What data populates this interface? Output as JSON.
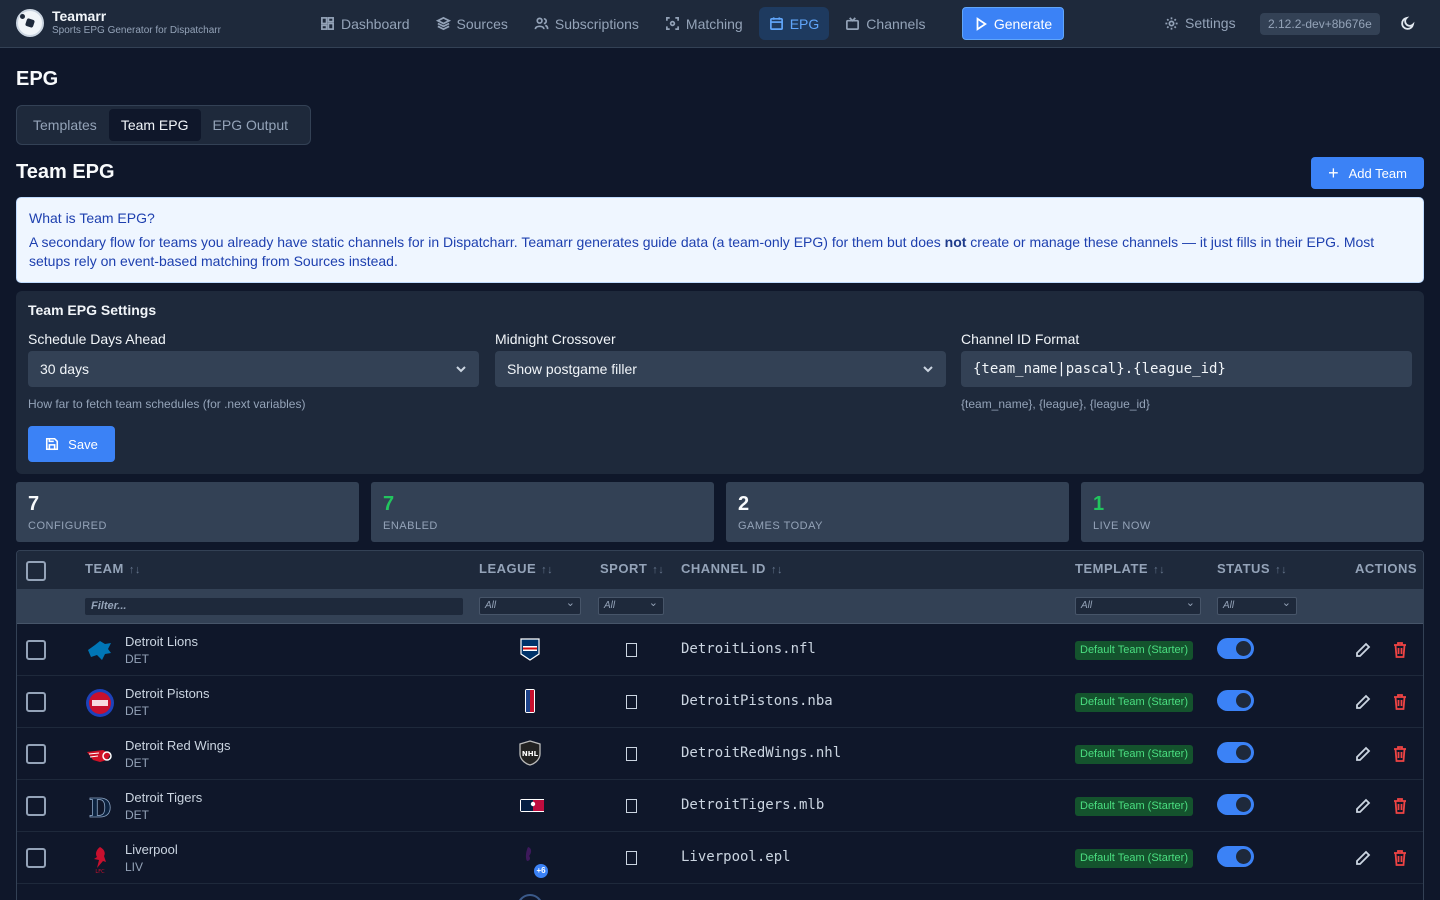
{
  "app": {
    "title": "Teamarr",
    "subtitle": "Sports EPG Generator for Dispatcharr",
    "version": "2.12.2-dev+8b676e"
  },
  "nav": {
    "dashboard": "Dashboard",
    "sources": "Sources",
    "subscriptions": "Subscriptions",
    "matching": "Matching",
    "epg": "EPG",
    "channels": "Channels",
    "generate": "Generate",
    "settings": "Settings"
  },
  "page": {
    "title": "EPG",
    "tabs": [
      "Templates",
      "Team EPG",
      "EPG Output"
    ],
    "active_tab": "Team EPG",
    "section_title": "Team EPG",
    "add_button": "Add Team"
  },
  "info": {
    "title": "What is Team EPG?",
    "body_before": "A secondary flow for teams you already have static channels for in Dispatcharr. Teamarr generates guide data (a team-only EPG) for them but does ",
    "body_bold": "not",
    "body_after": " create or manage these channels — it just fills in their EPG. Most setups rely on event-based matching from Sources instead."
  },
  "team_settings": {
    "title": "Team EPG Settings",
    "days_ahead_label": "Schedule Days Ahead",
    "days_ahead_value": "30 days",
    "days_ahead_hint": "How far to fetch team schedules (for .next variables)",
    "midnight_label": "Midnight Crossover",
    "midnight_value": "Show postgame filler",
    "channel_id_label": "Channel ID Format",
    "channel_id_value": "{team_name|pascal}.{league_id}",
    "channel_id_hint": "{team_name}, {league}, {league_id}",
    "save_label": "Save"
  },
  "stats": [
    {
      "value": "7",
      "label": "CONFIGURED",
      "color": "#f8fafc"
    },
    {
      "value": "7",
      "label": "ENABLED",
      "color": "#22c55e"
    },
    {
      "value": "2",
      "label": "GAMES TODAY",
      "color": "#f8fafc"
    },
    {
      "value": "1",
      "label": "LIVE NOW",
      "color": "#22c55e"
    }
  ],
  "table": {
    "headers": {
      "team": "TEAM",
      "league": "LEAGUE",
      "sport": "SPORT",
      "channel_id": "CHANNEL ID",
      "template": "TEMPLATE",
      "status": "STATUS",
      "actions": "ACTIONS"
    },
    "sort_glyph": "↑↓",
    "filter_placeholder": "Filter...",
    "filter_all": "All",
    "rows": [
      {
        "name": "Detroit Lions",
        "abbr": "DET",
        "league_icon": "nfl-logo-icon",
        "channel_id": "DetroitLions.nfl",
        "template": "Default Team (Starter)",
        "enabled": true
      },
      {
        "name": "Detroit Pistons",
        "abbr": "DET",
        "league_icon": "nba-logo-icon",
        "channel_id": "DetroitPistons.nba",
        "template": "Default Team (Starter)",
        "enabled": true
      },
      {
        "name": "Detroit Red Wings",
        "abbr": "DET",
        "league_icon": "nhl-logo-icon",
        "channel_id": "DetroitRedWings.nhl",
        "template": "Default Team (Starter)",
        "enabled": true
      },
      {
        "name": "Detroit Tigers",
        "abbr": "DET",
        "league_icon": "mlb-logo-icon",
        "channel_id": "DetroitTigers.mlb",
        "template": "Default Team (Starter)",
        "enabled": true
      },
      {
        "name": "Liverpool",
        "abbr": "LIV",
        "league_icon": "epl-logo-icon",
        "league_extra": "+6",
        "channel_id": "Liverpool.epl",
        "template": "Default Team (Starter)",
        "enabled": true
      }
    ]
  },
  "colors": {
    "accent": "#3b82f6",
    "background": "#0f172a",
    "surface": "#1e293b",
    "success": "#22c55e",
    "danger": "#ef4444"
  }
}
